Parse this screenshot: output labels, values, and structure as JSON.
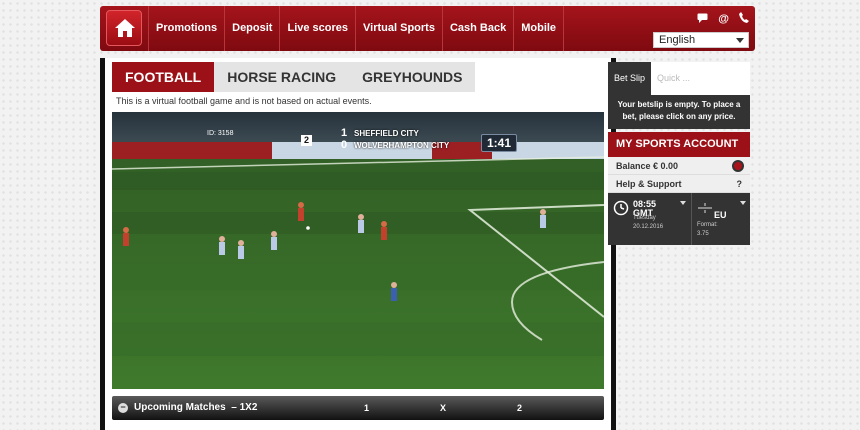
{
  "nav": {
    "items": [
      {
        "label": "Promotions"
      },
      {
        "label": "Deposit"
      },
      {
        "label": "Live scores"
      },
      {
        "label": "Virtual Sports"
      },
      {
        "label": "Cash Back"
      },
      {
        "label": "Mobile"
      }
    ],
    "language": "English",
    "icons": [
      "chat-icon",
      "email-icon",
      "phone-icon"
    ]
  },
  "tabs": [
    {
      "label": "FOOTBALL",
      "active": true
    },
    {
      "label": "HORSE RACING",
      "active": false
    },
    {
      "label": "GREYHOUNDS",
      "active": false
    }
  ],
  "notice": "This is a virtual football game and is not based on actual events.",
  "match": {
    "id_label": "ID: 3158",
    "half": "2",
    "home_team": "SHEFFIELD CITY",
    "away_team": "WOLVERHAMPTON CITY",
    "home_score": "1",
    "away_score": "0",
    "clock": "1:41"
  },
  "upcoming": {
    "title": "Upcoming Matches",
    "market": "– 1X2",
    "toggle": "−",
    "cols": [
      "1",
      "X",
      "2"
    ]
  },
  "betslip": {
    "tab_active": "Bet Slip",
    "tab_inactive": "Quick ...",
    "empty_message": "Your betslip is empty. To place a bet, please click on any price."
  },
  "account": {
    "title": "MY SPORTS ACCOUNT",
    "balance": "Balance € 0.00",
    "help": "Help & Support",
    "help_mark": "?"
  },
  "widget": {
    "time": "08:55",
    "tz": "GMT",
    "day": "Tuesday",
    "date": "20.12.2016",
    "format": "EU",
    "format_label": "Format:",
    "format_value": "3.75"
  },
  "colors": {
    "brand": "#9c1117",
    "dark": "#333333"
  }
}
